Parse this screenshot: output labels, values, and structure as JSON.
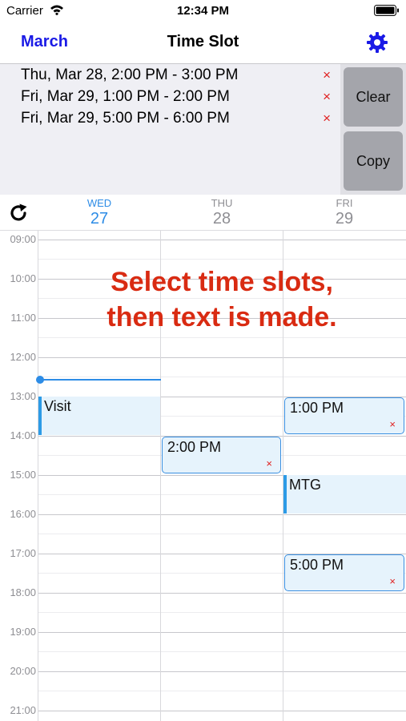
{
  "status_bar": {
    "carrier": "Carrier",
    "time": "12:34 PM"
  },
  "nav": {
    "back_label": "March",
    "title": "Time Slot"
  },
  "selected_slots": [
    {
      "text": "Thu, Mar 28, 2:00 PM - 3:00 PM",
      "remove": "×"
    },
    {
      "text": "Fri, Mar 29, 1:00 PM - 2:00 PM",
      "remove": "×"
    },
    {
      "text": "Fri, Mar 29, 5:00 PM - 6:00 PM",
      "remove": "×"
    }
  ],
  "buttons": {
    "clear": "Clear",
    "copy": "Copy"
  },
  "days": [
    {
      "weekday": "WED",
      "date": "27",
      "today": true
    },
    {
      "weekday": "THU",
      "date": "28",
      "today": false
    },
    {
      "weekday": "FRI",
      "date": "29",
      "today": false
    }
  ],
  "hours": [
    "09:00",
    "10:00",
    "11:00",
    "12:00",
    "13:00",
    "14:00",
    "15:00",
    "16:00",
    "17:00",
    "18:00",
    "19:00",
    "20:00",
    "21:00"
  ],
  "events": [
    {
      "title": "Visit",
      "day": "WED 27",
      "start": "13:00",
      "end": "14:00"
    },
    {
      "title": "MTG",
      "day": "FRI 29",
      "start": "15:00",
      "end": "16:00"
    }
  ],
  "slot_boxes": [
    {
      "label": "2:00 PM",
      "day": "THU 28",
      "start": "14:00",
      "end": "15:00",
      "remove": "×"
    },
    {
      "label": "1:00 PM",
      "day": "FRI 29",
      "start": "13:00",
      "end": "14:00",
      "remove": "×"
    },
    {
      "label": "5:00 PM",
      "day": "FRI 29",
      "start": "17:00",
      "end": "18:00",
      "remove": "×"
    }
  ],
  "overlay": {
    "line1": "Select time slots,",
    "line2": "then text is made."
  },
  "colors": {
    "accent": "#2d8ce6",
    "nav_link": "#1a1ae6",
    "remove": "#e02020",
    "overlay_text": "#d92b12"
  }
}
